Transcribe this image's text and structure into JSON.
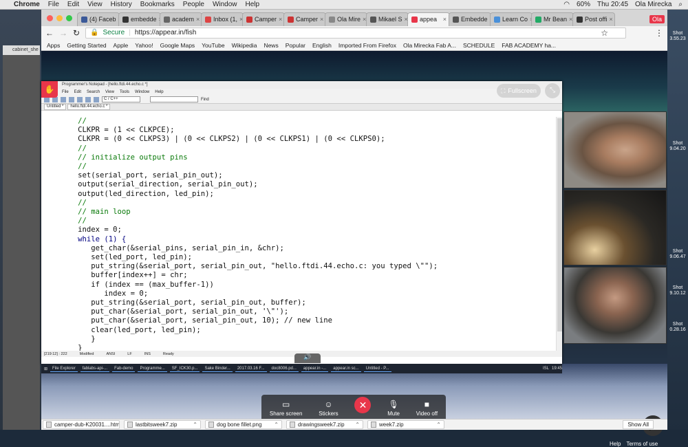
{
  "menubar": {
    "app": "Chrome",
    "items": [
      "File",
      "Edit",
      "View",
      "History",
      "Bookmarks",
      "People",
      "Window",
      "Help"
    ],
    "battery": "60%",
    "clock": "Thu 20:45",
    "user": "Ola Mirecka"
  },
  "desktop": {
    "finder_title": "cabinet_she",
    "shots": [
      {
        "a": "Shot",
        "b": "3.55.23"
      },
      {
        "a": "Shot",
        "b": "9.04.20"
      },
      {
        "a": "Shot",
        "b": "9.06.47"
      },
      {
        "a": "Shot",
        "b": "9.10.12"
      },
      {
        "a": "Shot",
        "b": "0.28.16"
      }
    ]
  },
  "tabs": [
    {
      "label": "(4) Faceb",
      "color": "#3b5998",
      "active": false
    },
    {
      "label": "embedde",
      "color": "#333",
      "active": false
    },
    {
      "label": "academ",
      "color": "#666",
      "active": false
    },
    {
      "label": "Inbox (1,",
      "color": "#d44",
      "active": false
    },
    {
      "label": "Camper",
      "color": "#c33",
      "active": false
    },
    {
      "label": "Camper",
      "color": "#c33",
      "active": false
    },
    {
      "label": "Ola Mire",
      "color": "#888",
      "active": false
    },
    {
      "label": "Mikael S",
      "color": "#555",
      "active": false
    },
    {
      "label": "appea",
      "color": "#e8364a",
      "active": true
    },
    {
      "label": "Embedde",
      "color": "#555",
      "active": false
    },
    {
      "label": "Learn Co",
      "color": "#4a90d9",
      "active": false
    },
    {
      "label": "Mr Bean",
      "color": "#2a6",
      "active": false
    },
    {
      "label": "Post offi",
      "color": "#333",
      "active": false
    }
  ],
  "profile": "Ola",
  "address": {
    "secure": "Secure",
    "url": "https://appear.in/fish"
  },
  "bookmarks": [
    "Apps",
    "Getting Started",
    "Apple",
    "Yahoo!",
    "Google Maps",
    "YouTube",
    "Wikipedia",
    "News",
    "Popular",
    "English",
    "Imported From Firefox",
    "Ola Mirecka Fab A...",
    "SCHEDULE",
    "FAB ACADEMY ha..."
  ],
  "editor": {
    "title": "Programmer's Notepad - [hello.ftdi.44.echo.c *]",
    "menu": [
      "File",
      "Edit",
      "Search",
      "View",
      "Tools",
      "Window",
      "Help"
    ],
    "scheme": "C / C++",
    "find": "Find",
    "tabs": [
      "Untitled *",
      "hello.ftdi.44.echo.c *"
    ],
    "status": [
      "[219:12] : 222",
      "Modified",
      "ANSI",
      "LF",
      "INS",
      "Ready"
    ]
  },
  "code_lines": [
    {
      "t": "   //",
      "cls": "c"
    },
    {
      "t": "   CLKPR = (1 << CLKPCE);",
      "cls": ""
    },
    {
      "t": "   CLKPR = (0 << CLKPS3) | (0 << CLKPS2) | (0 << CLKPS1) | (0 << CLKPS0);",
      "cls": ""
    },
    {
      "t": "   //",
      "cls": "c"
    },
    {
      "t": "   // initialize output pins",
      "cls": "c"
    },
    {
      "t": "   //",
      "cls": "c"
    },
    {
      "t": "   set(serial_port, serial_pin_out);",
      "cls": ""
    },
    {
      "t": "   output(serial_direction, serial_pin_out);",
      "cls": ""
    },
    {
      "t": "   output(led_direction, led_pin);",
      "cls": ""
    },
    {
      "t": "   //",
      "cls": "c"
    },
    {
      "t": "   // main loop",
      "cls": "c"
    },
    {
      "t": "   //",
      "cls": "c"
    },
    {
      "t": "   index = 0;",
      "cls": ""
    },
    {
      "t": "   while (1) {",
      "cls": "k"
    },
    {
      "t": "      get_char(&serial_pins, serial_pin_in, &chr);",
      "cls": ""
    },
    {
      "t": "      set(led_port, led_pin);",
      "cls": ""
    },
    {
      "t": "      put_string(&serial_port, serial_pin_out, \"hello.ftdi.44.echo.c: you typed \\\"\");",
      "cls": ""
    },
    {
      "t": "      buffer[index++] = chr;",
      "cls": ""
    },
    {
      "t": "      if (index == (max_buffer-1))",
      "cls": ""
    },
    {
      "t": "         index = 0;",
      "cls": ""
    },
    {
      "t": "      put_string(&serial_port, serial_pin_out, buffer);",
      "cls": ""
    },
    {
      "t": "      put_char(&serial_port, serial_pin_out, '\\\"');",
      "cls": ""
    },
    {
      "t": "      put_char(&serial_port, serial_pin_out, 10); // new line",
      "cls": ""
    },
    {
      "t": "      clear(led_port, led_pin);",
      "cls": ""
    },
    {
      "t": "      }",
      "cls": ""
    },
    {
      "t": "   }",
      "cls": ""
    }
  ],
  "fullscreen": "Fullscreen",
  "taskbar": [
    "File Explorer",
    "fablabs-api-...",
    "Fab-demo",
    "Programme...",
    "SF_ICK30.p...",
    "Sake Binder...",
    "2017.03.16 F...",
    "doc8006.pd...",
    "appear.in -...",
    "appear.in sc...",
    "Untitled - P..."
  ],
  "taskbar_tray": [
    "ISL",
    "19:45"
  ],
  "controls": {
    "share": "Share screen",
    "stickers": "Stickers",
    "mute": "Mute",
    "video": "Video off"
  },
  "help": "Help",
  "terms": "Terms of use",
  "downloads": [
    "camper-dub-K20031....html",
    "lastbitsweek7.zip",
    "dog bone fillet.png",
    "drawingsweek7.zip",
    "week7.zip"
  ],
  "show_all": "Show All"
}
